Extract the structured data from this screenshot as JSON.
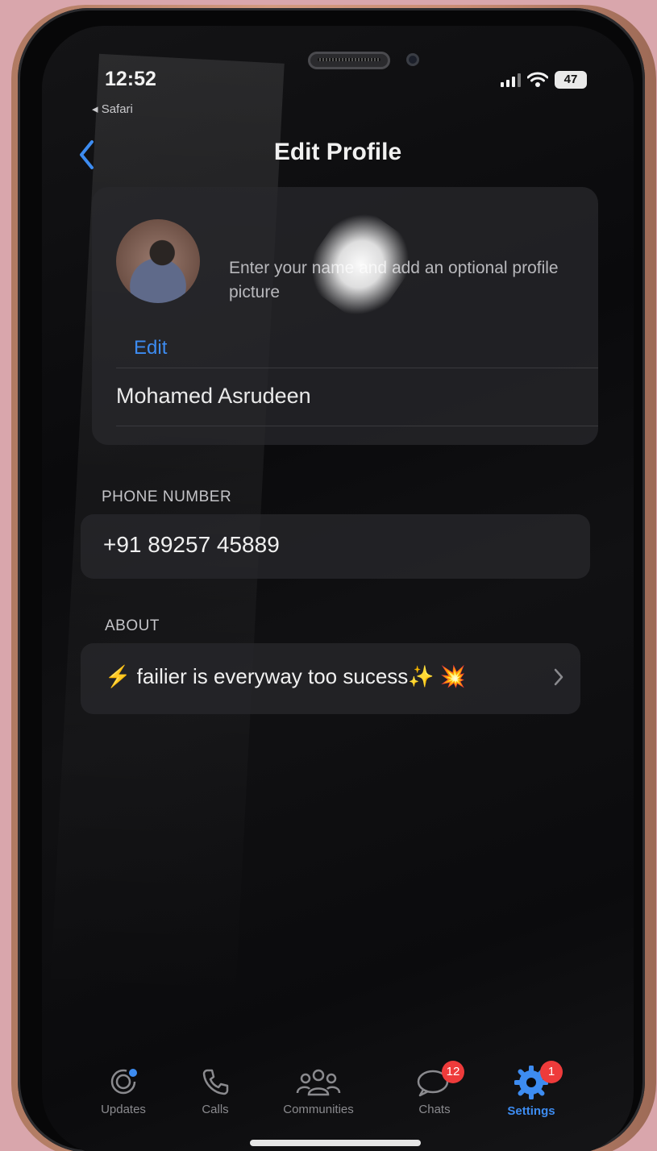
{
  "status_bar": {
    "time": "12:52",
    "back_app": "◂ Safari",
    "battery": "47"
  },
  "header": {
    "title": "Edit Profile"
  },
  "profile": {
    "edit_label": "Edit",
    "hint": "Enter your name and add an optional profile picture",
    "name": "Mohamed Asrudeen"
  },
  "phone_section": {
    "label": "PHONE NUMBER",
    "value": "+91 89257 45889"
  },
  "about_section": {
    "label": "ABOUT",
    "emoji_lead": "⚡",
    "text": "failier is everyway too sucess",
    "emoji_trail1": "✨",
    "emoji_trail2": "💥"
  },
  "tabbar": {
    "tabs": [
      {
        "label": "Updates",
        "icon": "updates-icon"
      },
      {
        "label": "Calls",
        "icon": "phone-icon"
      },
      {
        "label": "Communities",
        "icon": "communities-icon"
      },
      {
        "label": "Chats",
        "icon": "chats-icon",
        "badge": "12"
      },
      {
        "label": "Settings",
        "icon": "gear-icon",
        "badge": "1"
      }
    ],
    "active": "Settings"
  },
  "colors": {
    "accent": "#3d8cf1",
    "badge": "#ee3b3b",
    "background": "#0a0a0c"
  }
}
